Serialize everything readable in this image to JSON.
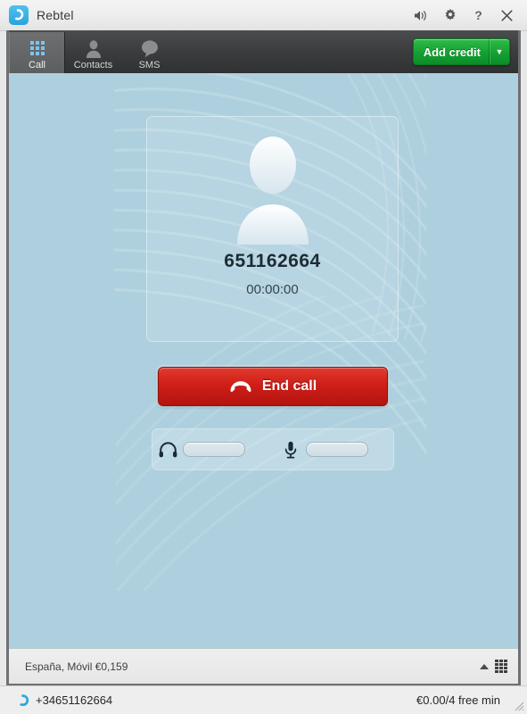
{
  "window": {
    "title": "Rebtel",
    "logo_icon": "phone-handset-icon",
    "controls": [
      {
        "name": "volume-icon",
        "label": "🔊"
      },
      {
        "name": "settings-gear-icon",
        "label": "⚙"
      },
      {
        "name": "help-icon",
        "label": "?"
      },
      {
        "name": "close-icon",
        "label": "✕"
      }
    ]
  },
  "toolbar": {
    "tabs": [
      {
        "label": "Call",
        "icon": "dialpad-icon",
        "active": true
      },
      {
        "label": "Contacts",
        "icon": "person-icon",
        "active": false
      },
      {
        "label": "SMS",
        "icon": "speech-bubble-icon",
        "active": false
      }
    ],
    "add_credit": {
      "label": "Add credit",
      "arrow": "▼",
      "color": "#14a233"
    }
  },
  "call": {
    "avatar_icon": "person-placeholder-icon",
    "number": "651162664",
    "timer": "00:00:00",
    "end_call": {
      "label": "End call",
      "icon": "hangup-handset-icon",
      "color": "#cf1f18"
    },
    "volume": {
      "speaker": {
        "icon": "headphones-icon",
        "slider": "speaker-volume-slider"
      },
      "microphone": {
        "icon": "microphone-icon",
        "slider": "mic-volume-slider"
      }
    }
  },
  "rate_bar": {
    "rate_text": "España, Móvil €0,159",
    "collapse_icon": "collapse-up-icon",
    "keypad_icon": "dialpad-icon"
  },
  "status_bar": {
    "line_icon": "phone-handset-icon",
    "number": "+34651162664",
    "credit": "€0.00/4 free min",
    "resize_grip": "resize-grip-icon"
  }
}
